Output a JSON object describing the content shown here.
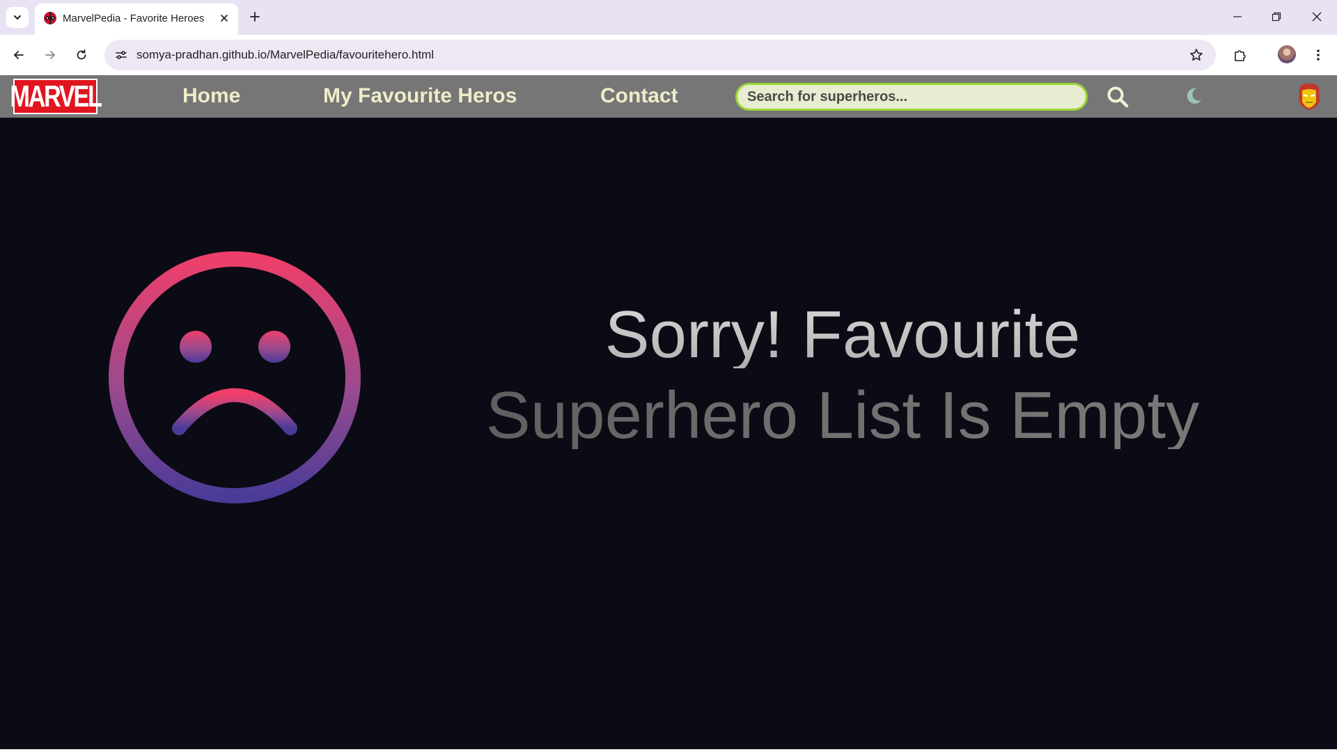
{
  "browser": {
    "tab": {
      "title": "MarvelPedia - Favorite Heroes",
      "favicon": "deadpool-favicon-icon"
    },
    "url": "somya-pradhan.github.io/MarvelPedia/favouritehero.html",
    "icons": {
      "tab_list": "chevron-down-icon",
      "close_tab": "close-icon",
      "new_tab": "plus-icon",
      "minimize": "minimize-icon",
      "restore": "restore-icon",
      "close_window": "close-icon",
      "back": "back-arrow-icon",
      "forward": "forward-arrow-icon",
      "reload": "reload-icon",
      "site_info": "site-settings-icon",
      "bookmark": "star-icon",
      "extensions": "puzzle-icon",
      "menu": "kebab-menu-icon"
    }
  },
  "site": {
    "logo_text": "MARVEL",
    "nav": {
      "home": "Home",
      "favourites": "My Favourite Heros",
      "contact": "Contact"
    },
    "search": {
      "placeholder": "Search for superheros...",
      "value": ""
    },
    "icons": {
      "search": "search-icon",
      "theme_toggle": "moon-icon",
      "user": "iron-man-icon"
    }
  },
  "main": {
    "message_line1": "Sorry! Favourite",
    "message_line2": "Superhero List Is Empty",
    "illustration": "sad-face-icon"
  },
  "colors": {
    "tabbar_bg": "#e9e2f5",
    "nav_bg": "#767676",
    "nav_text": "#efecc9",
    "search_border": "#9cd631",
    "page_bg": "#0a0b14",
    "logo_red": "#e0151f",
    "face_gradient_top": "#ee3f6b",
    "face_gradient_bottom": "#4a3b98"
  }
}
